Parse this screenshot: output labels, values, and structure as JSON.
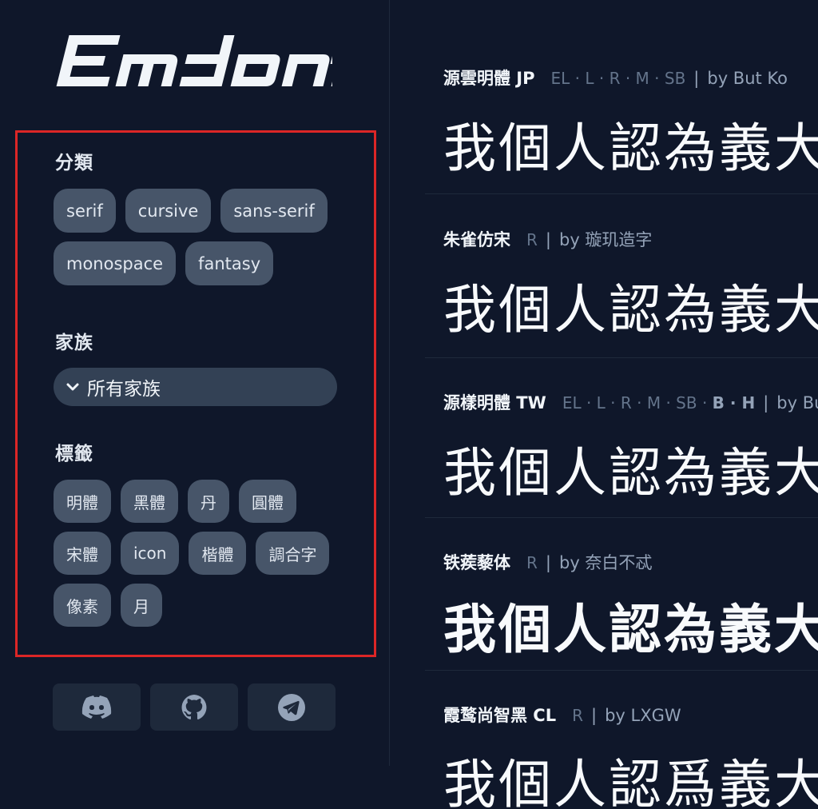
{
  "brand": {
    "logo_text": "Emdont"
  },
  "filters": {
    "category": {
      "title": "分類",
      "options": [
        "serif",
        "cursive",
        "sans-serif",
        "monospace",
        "fantasy"
      ]
    },
    "family": {
      "title": "家族",
      "selected": "所有家族"
    },
    "tags": {
      "title": "標籤",
      "options": [
        "明體",
        "黑體",
        "丹",
        "圓體",
        "宋體",
        "icon",
        "楷體",
        "調合字",
        "像素",
        "月"
      ]
    }
  },
  "social": [
    "discord-icon",
    "github-icon",
    "telegram-icon"
  ],
  "fonts": [
    {
      "name": "源雲明體 JP",
      "weights": "EL · L · R · M · SB",
      "bold_weights": "",
      "author": "by But Ko",
      "sample": "我個人認為義大利"
    },
    {
      "name": "朱雀仿宋",
      "weights": "R",
      "bold_weights": "",
      "author": "by 璇玑造字",
      "sample": "我個人認為義大利"
    },
    {
      "name": "源樣明體 TW",
      "weights": "EL · L · R · M · SB · ",
      "bold_weights": "B · H",
      "author": "by Bu",
      "sample": "我個人認為義大利"
    },
    {
      "name": "铁蒺藜体",
      "weights": "R",
      "bold_weights": "",
      "author": "by 奈白不忒",
      "sample": "我個人認為義大利"
    },
    {
      "name": "霞鹜尚智黑 CL",
      "weights": "R",
      "bold_weights": "",
      "author": "by LXGW",
      "sample": "我個人認爲義大利"
    }
  ],
  "colors": {
    "background": "#0f172a",
    "chip": "#475569",
    "select": "#334155",
    "highlight_border": "#dc2626"
  }
}
